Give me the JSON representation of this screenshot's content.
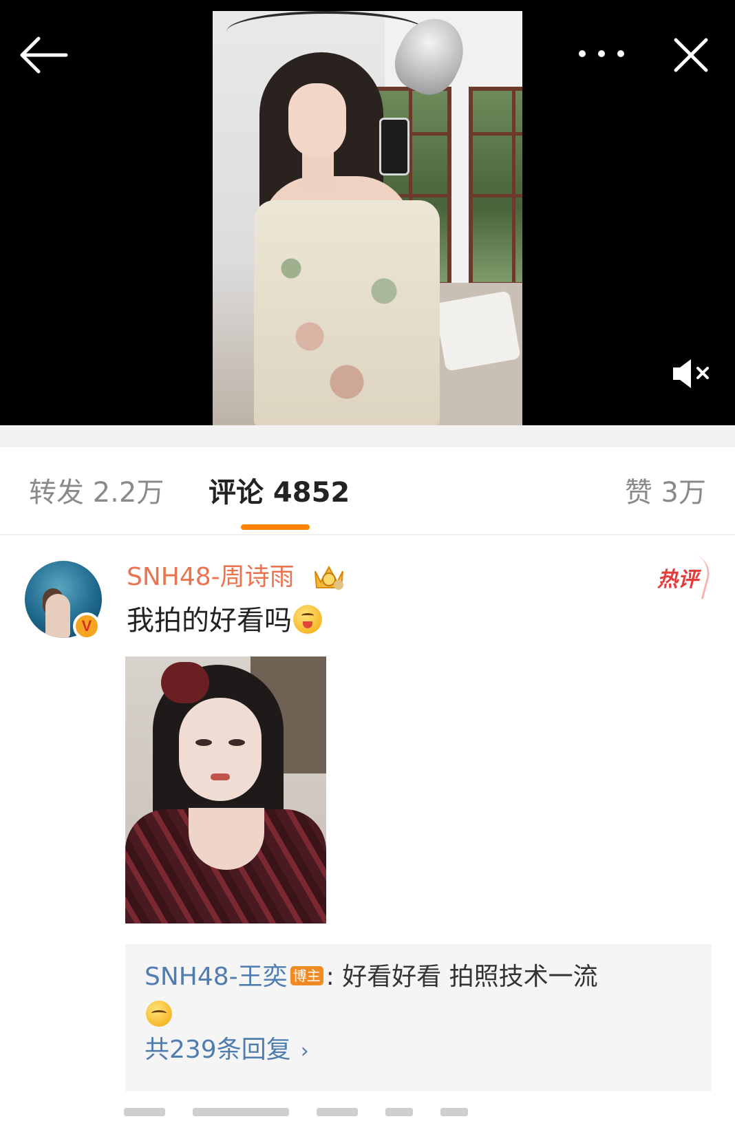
{
  "tabs": {
    "repost": "转发 2.2万",
    "comments": "评论 4852",
    "likes": "赞 3万"
  },
  "accent_color": "#ff8200",
  "icons": {
    "back": "arrow-left-icon",
    "more": "more-dots-icon",
    "close": "close-icon",
    "mute": "volume-muted-icon"
  },
  "comment": {
    "username": "SNH48-周诗雨",
    "badge": "热评",
    "text": "我拍的好看吗",
    "reply": {
      "username": "SNH48-王奕",
      "author_tag": "博主",
      "text": ": 好看好看 拍照技术一流",
      "more": "共239条回复"
    }
  }
}
